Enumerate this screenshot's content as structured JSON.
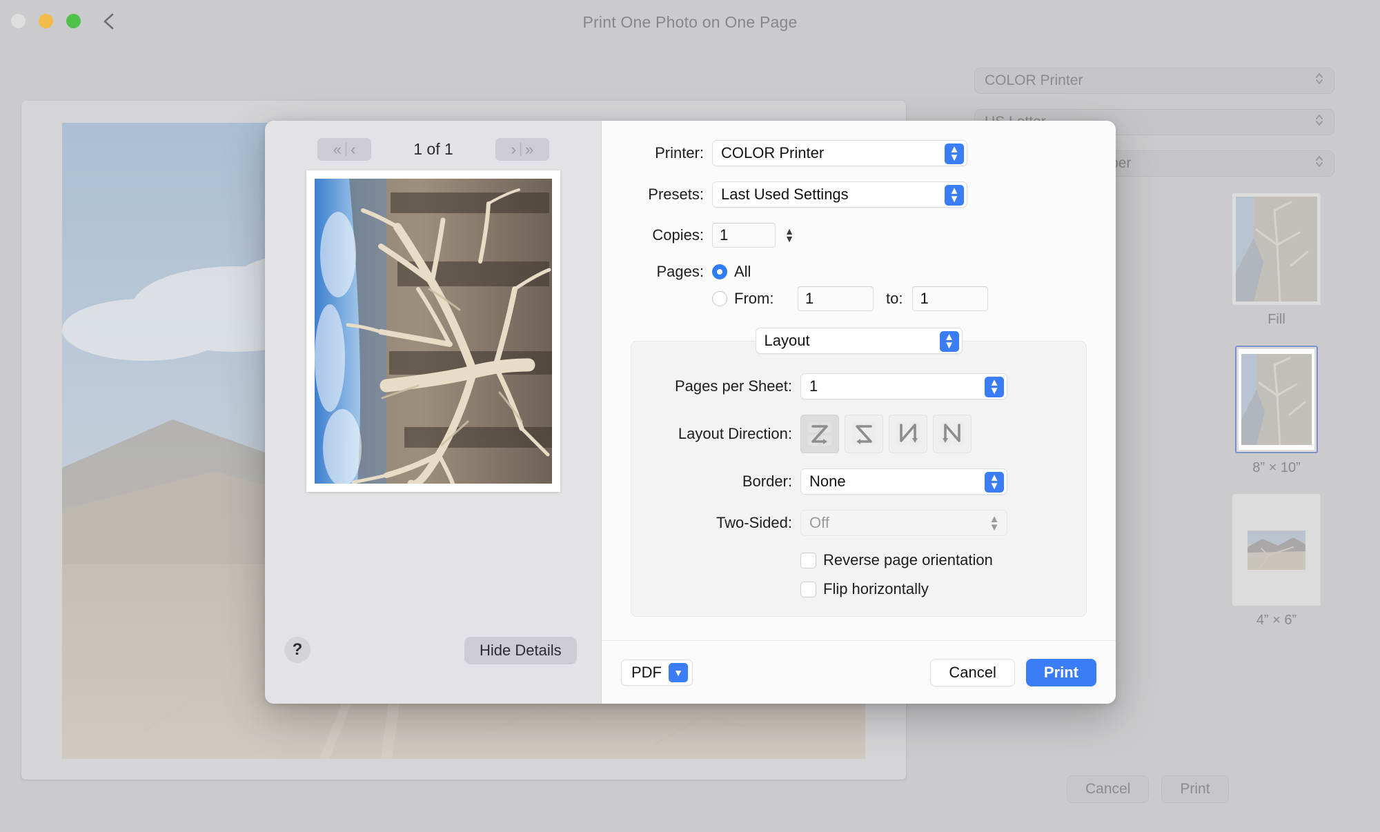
{
  "window": {
    "title": "Print One Photo on One Page",
    "traffic_lights": [
      "close",
      "minimize",
      "maximize"
    ],
    "back_button": "back-chevron"
  },
  "background_panel": {
    "popups": [
      {
        "value": "COLOR Printer"
      },
      {
        "value": "US Letter"
      },
      {
        "value": "er / Bright White Paper"
      }
    ],
    "thumbnails": [
      {
        "label": "Fill",
        "selected": false
      },
      {
        "label": "8” × 10”",
        "selected": true
      },
      {
        "label": "4” × 6”",
        "selected": false
      }
    ],
    "buttons": {
      "cancel": "Cancel",
      "print": "Print"
    }
  },
  "print_sheet": {
    "preview": {
      "first_label": "«",
      "prev_label": "‹",
      "next_label": "›",
      "last_label": "»",
      "separator": "|",
      "page_count": "1 of 1"
    },
    "help_label": "?",
    "hide_details_label": "Hide Details",
    "fields": {
      "printer_label": "Printer:",
      "printer_value": "COLOR Printer",
      "presets_label": "Presets:",
      "presets_value": "Last Used Settings",
      "copies_label": "Copies:",
      "copies_value": "1",
      "pages_label": "Pages:",
      "pages_all_label": "All",
      "pages_from_label": "From:",
      "pages_from_value": "1",
      "pages_to_label": "to:",
      "pages_to_value": "1",
      "pages_selected": "all"
    },
    "pane": {
      "selected_pane": "Layout",
      "pages_per_sheet_label": "Pages per Sheet:",
      "pages_per_sheet_value": "1",
      "layout_direction_label": "Layout Direction:",
      "layout_directions": [
        {
          "name": "z-left-right-top-bottom",
          "selected": true
        },
        {
          "name": "z-right-left-top-bottom",
          "selected": false
        },
        {
          "name": "n-top-bottom-left-right",
          "selected": false
        },
        {
          "name": "n-top-bottom-right-left",
          "selected": false
        }
      ],
      "border_label": "Border:",
      "border_value": "None",
      "two_sided_label": "Two-Sided:",
      "two_sided_value": "Off",
      "two_sided_enabled": false,
      "reverse_page_orientation_label": "Reverse page orientation",
      "reverse_page_orientation_checked": false,
      "flip_horizontally_label": "Flip horizontally",
      "flip_horizontally_checked": false
    },
    "footer": {
      "pdf_label": "PDF",
      "cancel_label": "Cancel",
      "print_label": "Print"
    }
  },
  "colors": {
    "accent": "#3b7df6",
    "selection_border": "#7b92c7",
    "sheet_bg": "#fbfbfb",
    "preview_bg": "#e3e2e7",
    "window_bg": "#cbcbcd"
  }
}
